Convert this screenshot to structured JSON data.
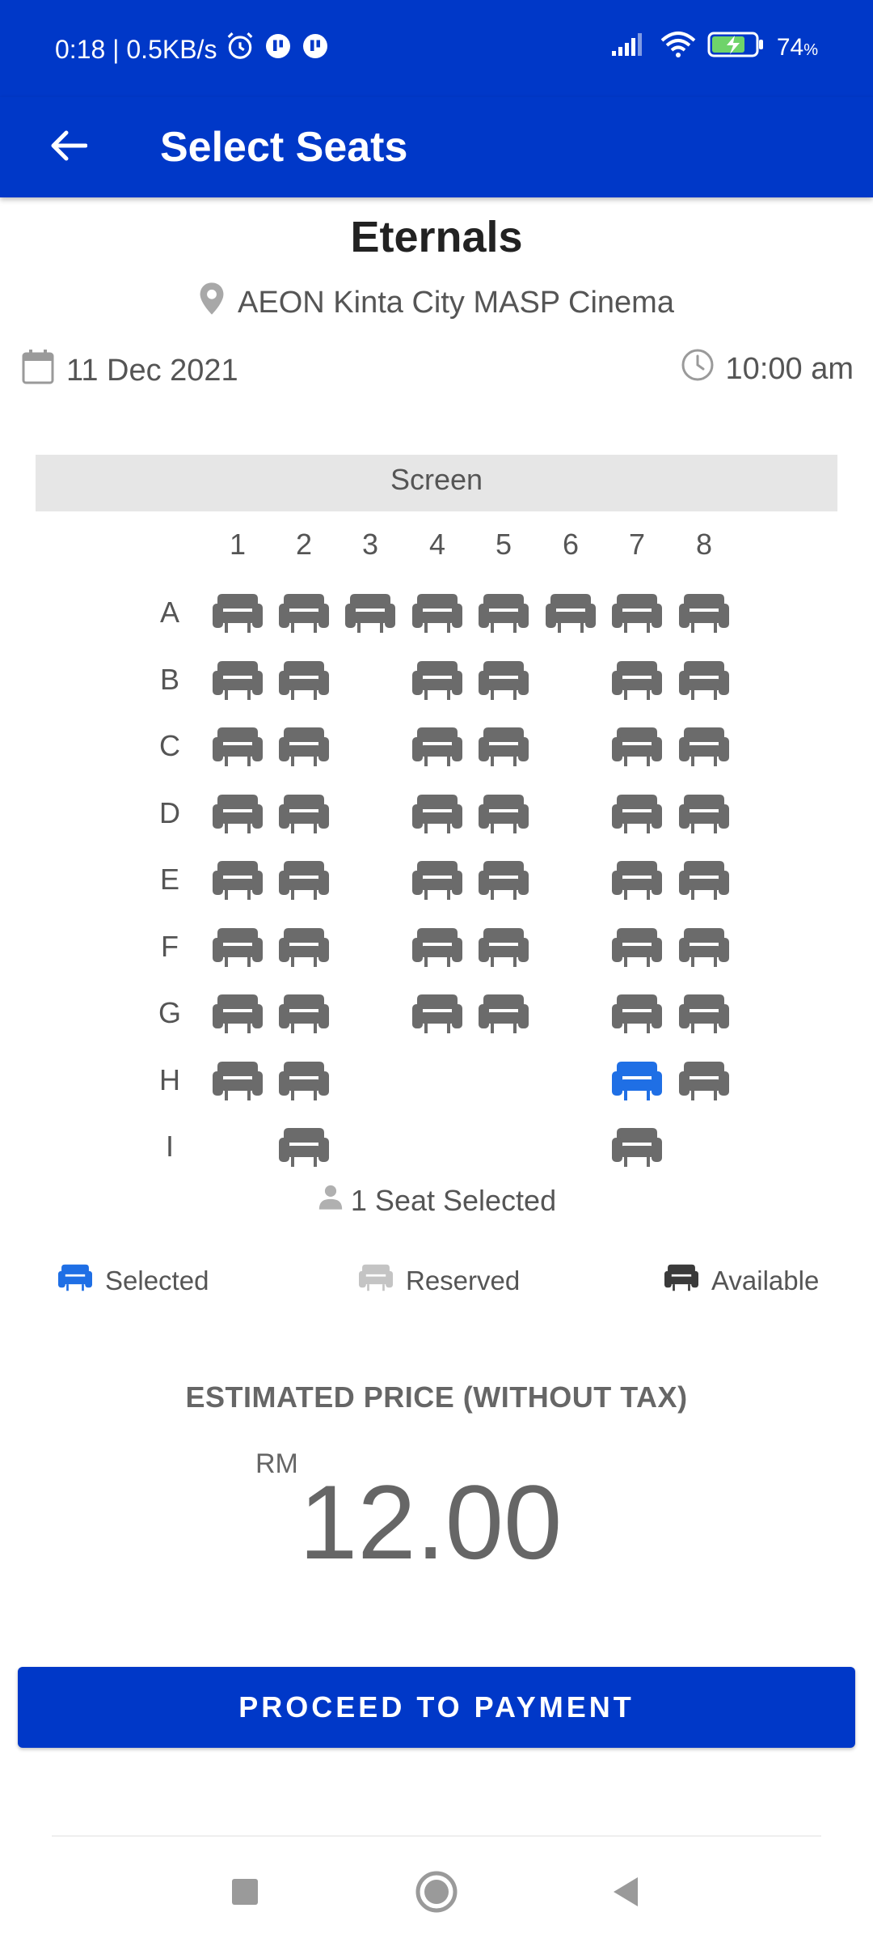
{
  "status_bar": {
    "time_speed": "0:18 | 0.5KB/s",
    "battery": "74",
    "battery_unit": "%"
  },
  "app_bar": {
    "title": "Select Seats"
  },
  "movie": {
    "title": "Eternals",
    "cinema": "AEON Kinta City MASP Cinema",
    "date": "11 Dec 2021",
    "time": "10:00 am"
  },
  "screen_label": "Screen",
  "columns": [
    "1",
    "2",
    "3",
    "4",
    "5",
    "6",
    "7",
    "8"
  ],
  "rows": [
    {
      "label": "A",
      "seats": [
        "available",
        "available",
        "available",
        "available",
        "available",
        "available",
        "available",
        "available"
      ]
    },
    {
      "label": "B",
      "seats": [
        "available",
        "available",
        null,
        "available",
        "available",
        null,
        "available",
        "available"
      ]
    },
    {
      "label": "C",
      "seats": [
        "available",
        "available",
        null,
        "available",
        "available",
        null,
        "available",
        "available"
      ]
    },
    {
      "label": "D",
      "seats": [
        "available",
        "available",
        null,
        "available",
        "available",
        null,
        "available",
        "available"
      ]
    },
    {
      "label": "E",
      "seats": [
        "available",
        "available",
        null,
        "available",
        "available",
        null,
        "available",
        "available"
      ]
    },
    {
      "label": "F",
      "seats": [
        "available",
        "available",
        null,
        "available",
        "available",
        null,
        "available",
        "available"
      ]
    },
    {
      "label": "G",
      "seats": [
        "available",
        "available",
        null,
        "available",
        "available",
        null,
        "available",
        "available"
      ]
    },
    {
      "label": "H",
      "seats": [
        "available",
        "available",
        null,
        null,
        null,
        null,
        "selected",
        "available"
      ]
    },
    {
      "label": "I",
      "seats": [
        null,
        "available",
        null,
        null,
        null,
        null,
        "available",
        null
      ]
    }
  ],
  "seat_count_text": "1 Seat Selected",
  "legend": {
    "selected": "Selected",
    "reserved": "Reserved",
    "available": "Available"
  },
  "seat_colors": {
    "available": "#6b6b6b",
    "selected": "#1f6fe5",
    "reserved": "#c4c4c4",
    "legend_available": "#3a3a3a"
  },
  "price": {
    "label": "ESTIMATED PRICE (WITHOUT TAX)",
    "currency": "RM",
    "amount": "12.00"
  },
  "button": {
    "proceed_label": "PROCEED TO PAYMENT"
  },
  "colors": {
    "primary": "#0038c8"
  }
}
